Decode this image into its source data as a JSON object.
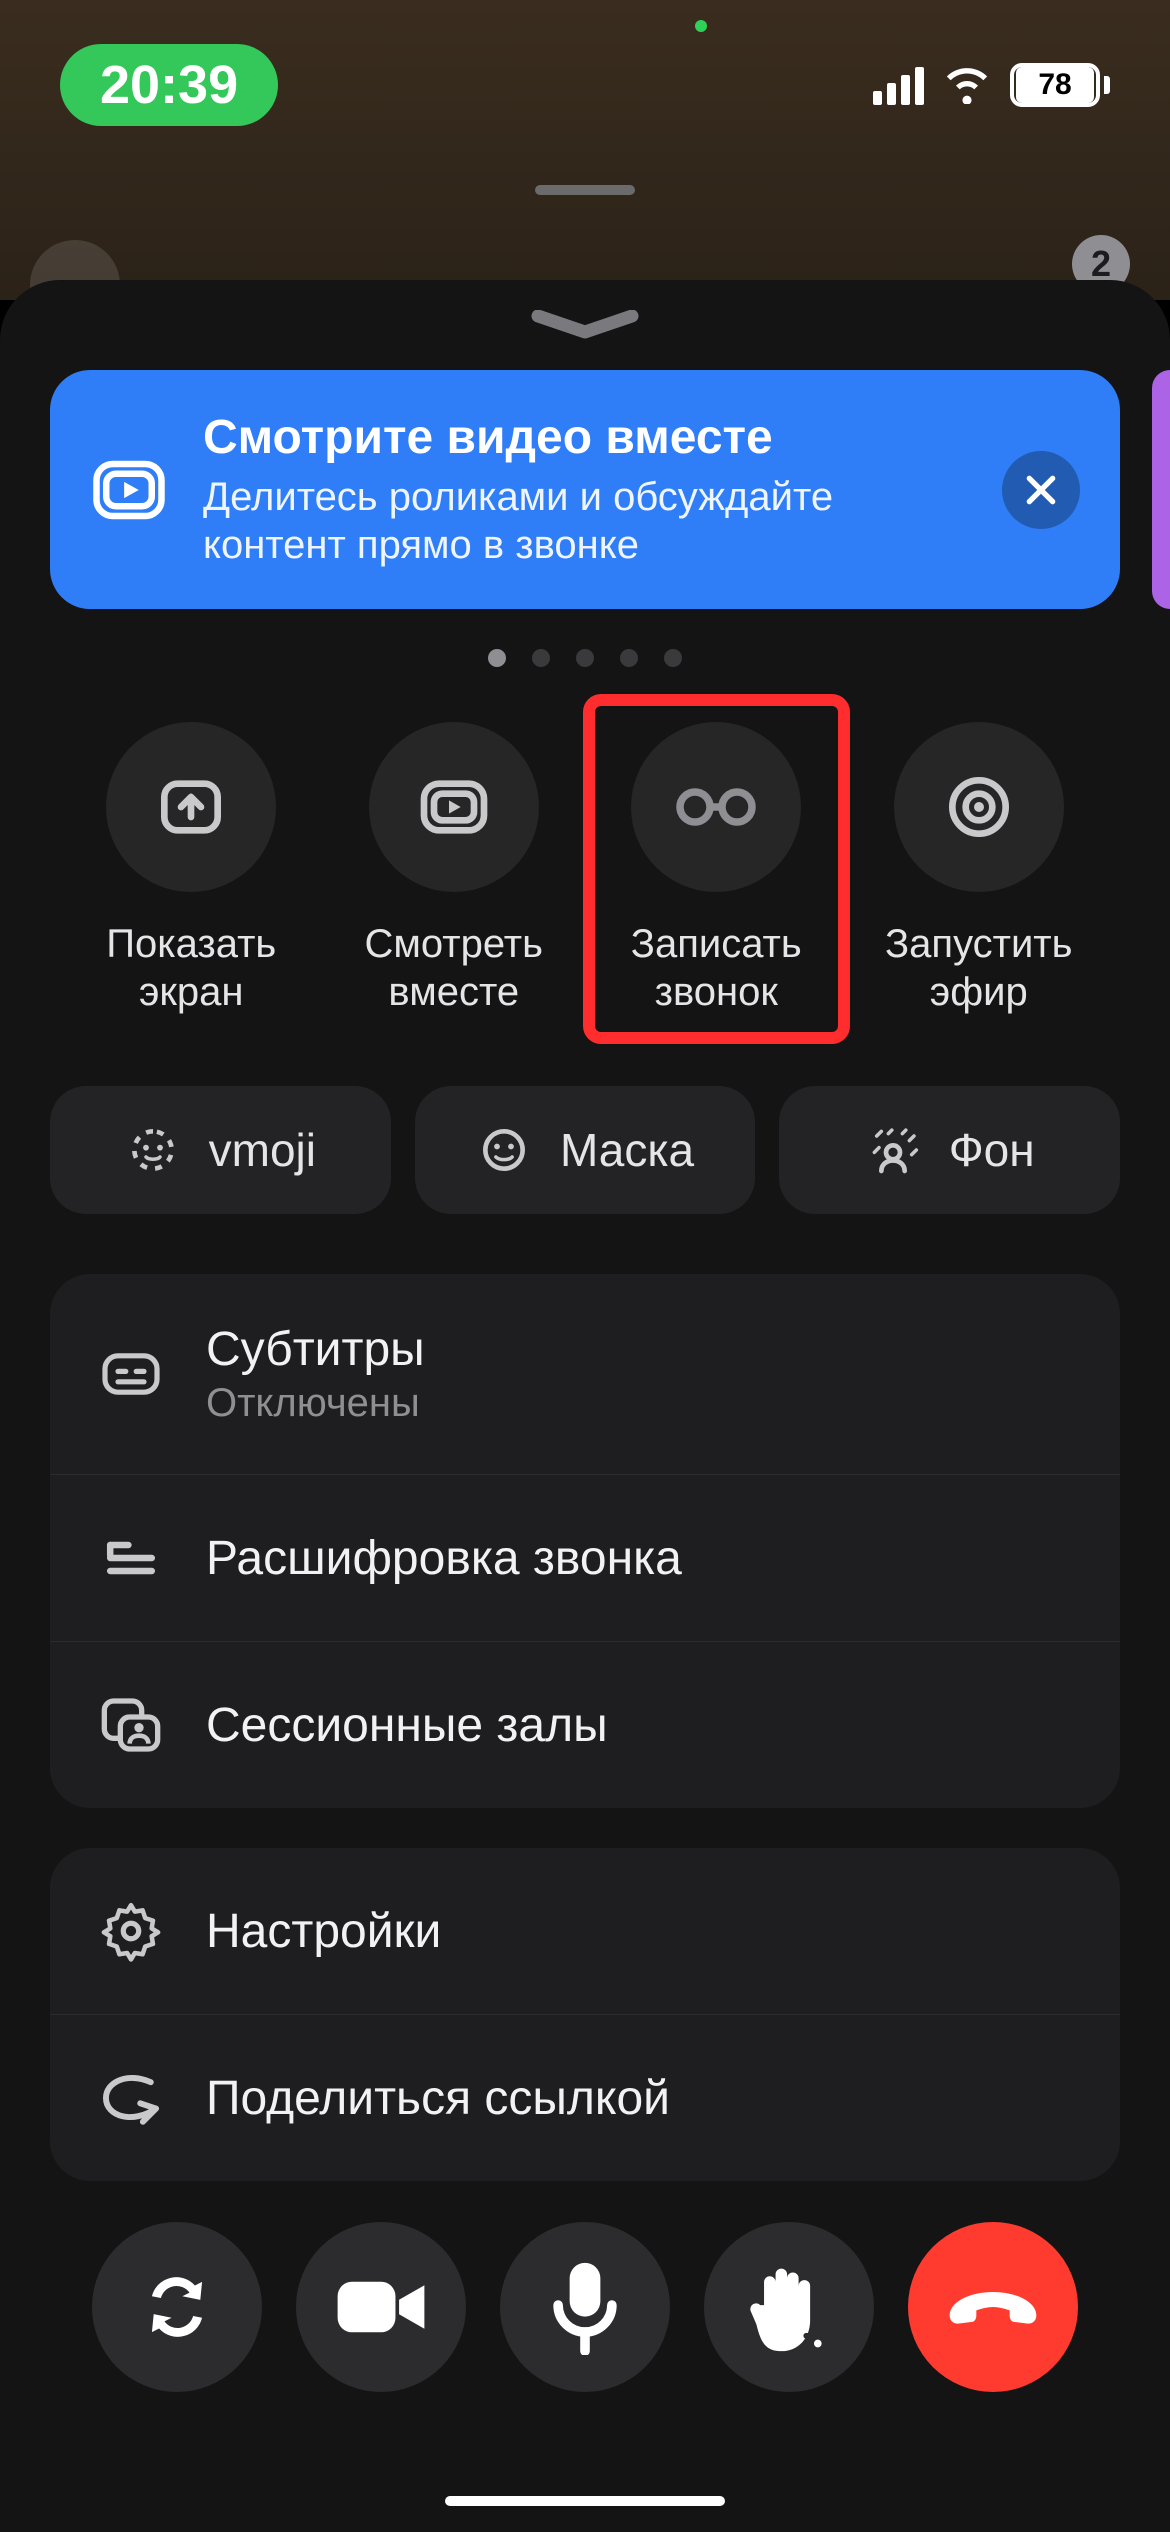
{
  "status": {
    "time": "20:39",
    "battery": "78",
    "badge_count": "2"
  },
  "banner": {
    "title": "Смотрите видео вместе",
    "subtitle": "Делитесь роликами и обсуждайте контент прямо в звонке"
  },
  "carousel": {
    "active_index": 0,
    "count": 5
  },
  "actions": [
    {
      "id": "share-screen",
      "label": "Показать\nэкран"
    },
    {
      "id": "watch-together",
      "label": "Смотреть\nвместе"
    },
    {
      "id": "record-call",
      "label": "Записать\nзвонок",
      "highlight": true
    },
    {
      "id": "go-live",
      "label": "Запустить\nэфир"
    }
  ],
  "chips": [
    {
      "id": "vmoji",
      "label": "vmoji"
    },
    {
      "id": "mask",
      "label": "Маска"
    },
    {
      "id": "background",
      "label": "Фон"
    }
  ],
  "menu1": [
    {
      "id": "subtitles",
      "title": "Субтитры",
      "subtitle": "Отключены"
    },
    {
      "id": "transcript",
      "title": "Расшифровка звонка"
    },
    {
      "id": "breakouts",
      "title": "Сессионные залы"
    }
  ],
  "menu2": [
    {
      "id": "settings",
      "title": "Настройки"
    },
    {
      "id": "share",
      "title": "Поделиться ссылкой"
    }
  ],
  "controls": [
    {
      "id": "switch-camera"
    },
    {
      "id": "video"
    },
    {
      "id": "mic"
    },
    {
      "id": "raise-hand"
    },
    {
      "id": "end-call"
    }
  ]
}
